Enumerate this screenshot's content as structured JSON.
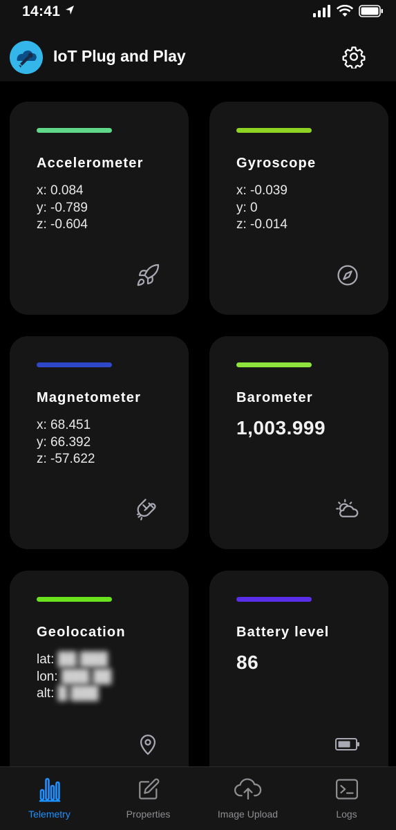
{
  "status_bar": {
    "time": "14:41"
  },
  "header": {
    "title": "IoT Plug and Play"
  },
  "cards": {
    "accelerometer": {
      "title": "Accelerometer",
      "x": "x: 0.084",
      "y": "y: -0.789",
      "z": "z: -0.604",
      "accent": "#5fd88a"
    },
    "gyroscope": {
      "title": "Gyroscope",
      "x": "x: -0.039",
      "y": "y: 0",
      "z": "z: -0.014",
      "accent": "#8ed323"
    },
    "magnetometer": {
      "title": "Magnetometer",
      "x": "x: 68.451",
      "y": "y: 66.392",
      "z": "z: -57.622",
      "accent": "#2f47c9"
    },
    "barometer": {
      "title": "Barometer",
      "value": "1,003.999",
      "accent": "#8ee33c"
    },
    "geolocation": {
      "title": "Geolocation",
      "lat_label": "lat:",
      "lon_label": "lon:",
      "alt_label": "alt:",
      "accent": "#6ae21e"
    },
    "battery": {
      "title": "Battery level",
      "value": "86",
      "accent": "#5b2eea"
    }
  },
  "tabs": [
    {
      "label": "Telemetry",
      "icon": "bar-chart-icon",
      "active": true
    },
    {
      "label": "Properties",
      "icon": "edit-icon",
      "active": false
    },
    {
      "label": "Image Upload",
      "icon": "cloud-upload-icon",
      "active": false
    },
    {
      "label": "Logs",
      "icon": "terminal-icon",
      "active": false
    }
  ],
  "colors": {
    "background": "#000000",
    "card": "#161616",
    "active_tab": "#1e90ff",
    "inactive_tab": "#8e8e93",
    "icon": "#a9a9b3"
  }
}
